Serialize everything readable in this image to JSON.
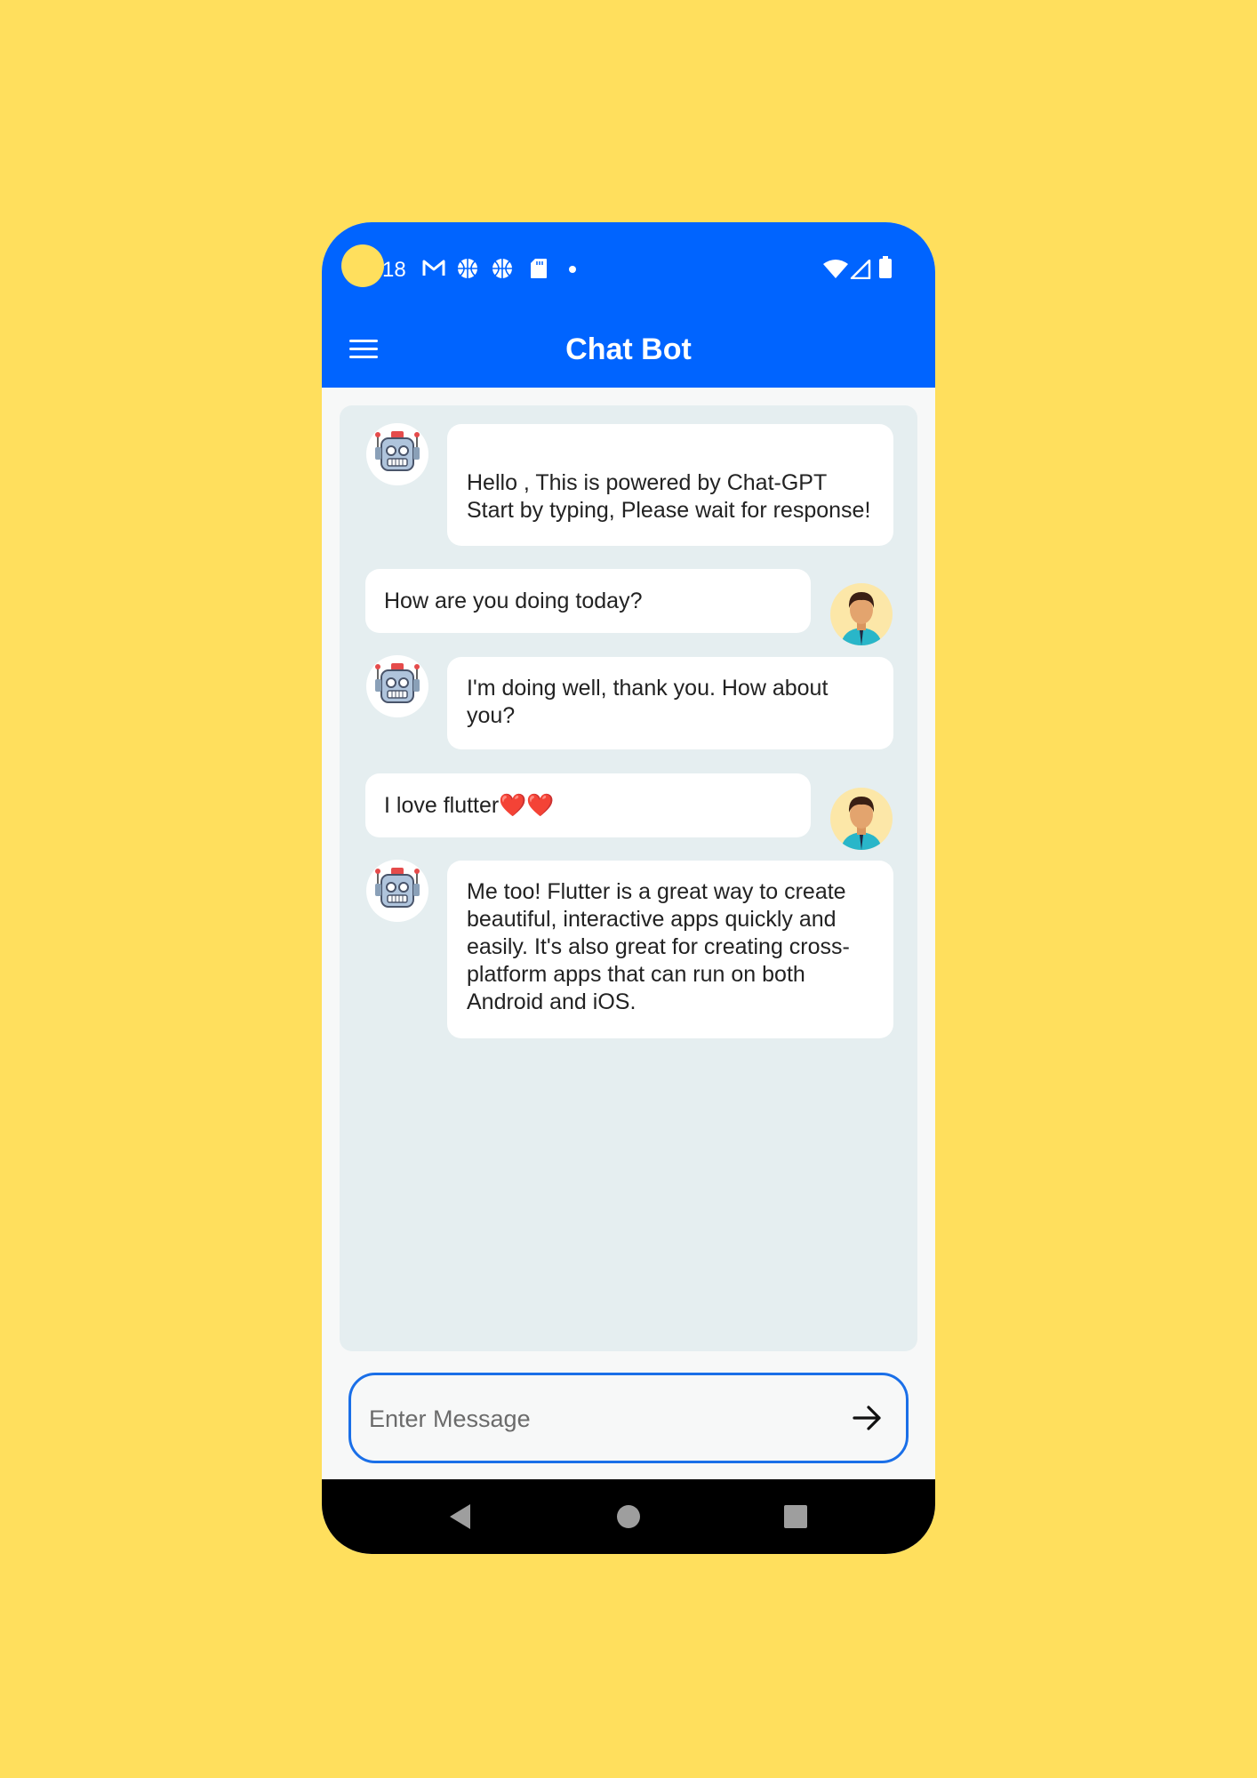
{
  "status_bar": {
    "time": "18",
    "left_icons": [
      "gmail-icon",
      "basketball-icon",
      "basketball-icon",
      "sd-card-icon",
      "dot-icon"
    ],
    "right_icons": [
      "wifi-icon",
      "signal-icon",
      "battery-icon"
    ]
  },
  "app_bar": {
    "title": "Chat Bot",
    "menu_icon": "menu-icon",
    "background": "#0064FF"
  },
  "messages": [
    {
      "sender": "bot",
      "text": "Hello , This is powered by Chat-GPT\n Start by typing, Please wait for response!"
    },
    {
      "sender": "user",
      "text": "How are you doing today?"
    },
    {
      "sender": "bot",
      "text": "I'm doing well, thank you. How about you?"
    },
    {
      "sender": "user",
      "text": "I love flutter❤️❤️"
    },
    {
      "sender": "bot",
      "text": "Me too! Flutter is a great way to create beautiful, interactive apps quickly and easily. It's also great for creating cross-platform apps that can run on both Android and iOS."
    }
  ],
  "input": {
    "placeholder": "Enter Message",
    "value": "",
    "send_icon": "arrow-right-icon"
  },
  "nav_bar": {
    "icons": [
      "back-icon",
      "home-icon",
      "recents-icon"
    ]
  },
  "colors": {
    "page_background": "#FFDF5D",
    "primary": "#0064FF",
    "chat_background": "#E5EEF0",
    "input_border": "#1A6FE8"
  }
}
